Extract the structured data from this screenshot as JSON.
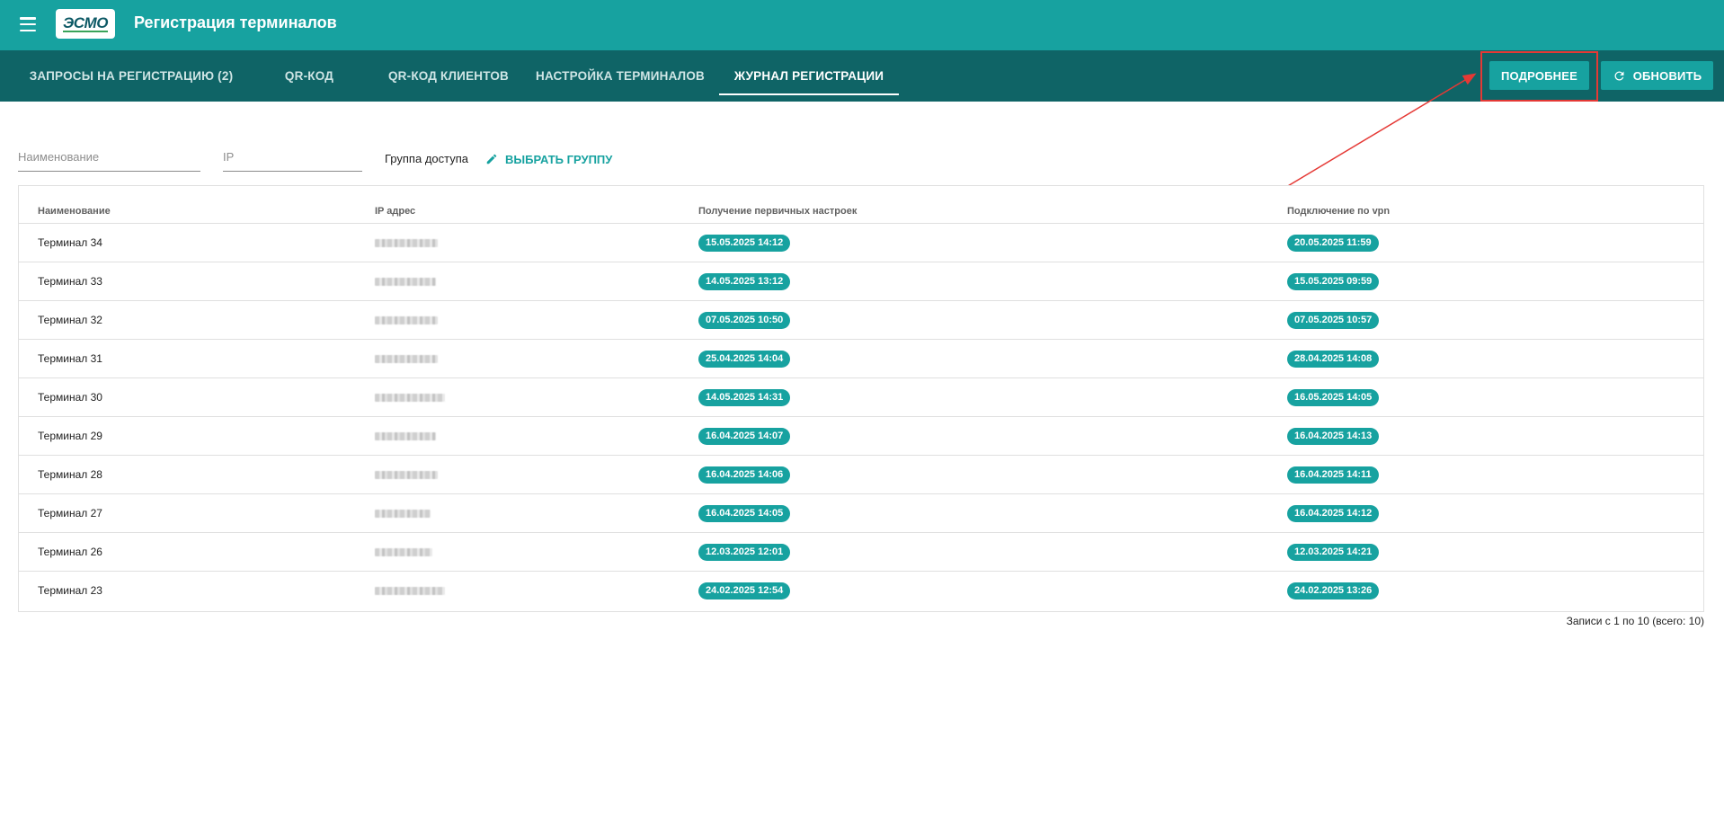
{
  "header": {
    "title": "Регистрация терминалов",
    "logo_text": "ЭСМО",
    "menu_icon": "hamburger-menu-icon"
  },
  "tabs": [
    {
      "label": "ЗАПРОСЫ НА РЕГИСТРАЦИЮ (2)",
      "active": false
    },
    {
      "label": "QR-КОД",
      "active": false
    },
    {
      "label": "QR-КОД КЛИЕНТОВ",
      "active": false
    },
    {
      "label": "НАСТРОЙКА ТЕРМИНАЛОВ",
      "active": false
    },
    {
      "label": "ЖУРНАЛ РЕГИСТРАЦИИ",
      "active": true
    }
  ],
  "actions": {
    "details_label": "ПОДРОБНЕЕ",
    "refresh_label": "ОБНОВИТЬ",
    "refresh_icon": "refresh-icon"
  },
  "filters": {
    "name_placeholder": "Наименование",
    "ip_placeholder": "IP",
    "group_label": "Группа доступа",
    "choose_group_label": "ВЫБРАТЬ ГРУППУ",
    "choose_group_icon": "pencil-icon"
  },
  "table": {
    "columns": [
      "Наименование",
      "IP адрес",
      "Получение первичных настроек",
      "Подключение по vpn"
    ],
    "rows": [
      {
        "name": "Терминал 34",
        "received": "15.05.2025 14:12",
        "vpn": "20.05.2025 11:59"
      },
      {
        "name": "Терминал 33",
        "received": "14.05.2025 13:12",
        "vpn": "15.05.2025 09:59"
      },
      {
        "name": "Терминал 32",
        "received": "07.05.2025 10:50",
        "vpn": "07.05.2025 10:57"
      },
      {
        "name": "Терминал 31",
        "received": "25.04.2025 14:04",
        "vpn": "28.04.2025 14:08"
      },
      {
        "name": "Терминал 30",
        "received": "14.05.2025 14:31",
        "vpn": "16.05.2025 14:05"
      },
      {
        "name": "Терминал 29",
        "received": "16.04.2025 14:07",
        "vpn": "16.04.2025 14:13"
      },
      {
        "name": "Терминал 28",
        "received": "16.04.2025 14:06",
        "vpn": "16.04.2025 14:11"
      },
      {
        "name": "Терминал 27",
        "received": "16.04.2025 14:05",
        "vpn": "16.04.2025 14:12"
      },
      {
        "name": "Терминал 26",
        "received": "12.03.2025 12:01",
        "vpn": "12.03.2025 14:21"
      },
      {
        "name": "Терминал 23",
        "received": "24.02.2025 12:54",
        "vpn": "24.02.2025 13:26"
      }
    ]
  },
  "pagination": {
    "summary": "Записи с 1 по 10 (всего: 10)"
  },
  "colors": {
    "primary": "#17a2a0",
    "tabbar": "#0f6466",
    "annotation": "#e53935"
  }
}
